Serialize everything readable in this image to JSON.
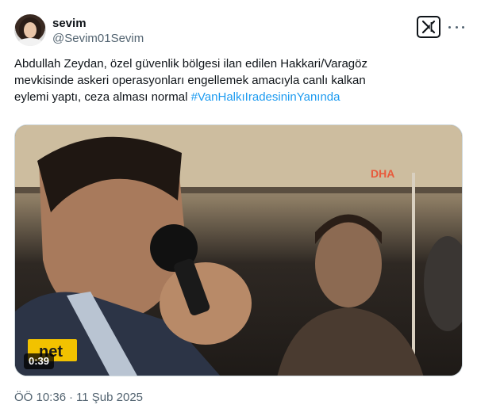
{
  "author": {
    "name": "sevim",
    "handle": "@Sevim01Sevim"
  },
  "tweet": {
    "lines": [
      "Abdullah Zeydan, özel güvenlik bölgesi ilan edilen Hakkari/Varagöz",
      "mevkisinde askeri operasyonları engellemek amacıyla canlı kalkan",
      "eylemi yaptı, ceza alması normal "
    ],
    "hashtag": "#VanHalkıIradesininYanında"
  },
  "media": {
    "watermark": "DHA",
    "corner_logo": "net",
    "duration": "0:39"
  },
  "meta": {
    "time": "ÖÖ 10:36",
    "separator": "·",
    "date": "11 Şub 2025"
  },
  "icons": {
    "brand": "x-logo-icon",
    "menu": "more-icon"
  },
  "colors": {
    "text": "#0f1419",
    "secondary": "#536471",
    "link": "#1d9bf0"
  }
}
